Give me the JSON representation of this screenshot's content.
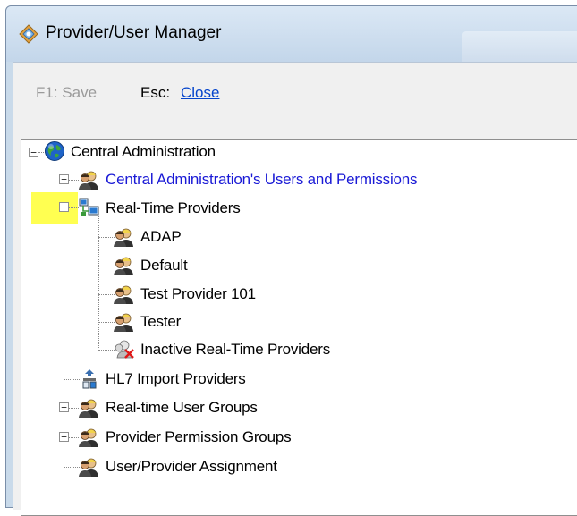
{
  "window": {
    "title": "Provider/User Manager"
  },
  "toolbar": {
    "save_label": "F1: Save",
    "esc_key": "Esc:",
    "close_label": "Close"
  },
  "tree": {
    "root": "Central Administration",
    "items": {
      "users_permissions": "Central Administration's Users and Permissions",
      "realtime_providers": "Real-Time Providers",
      "adap": "ADAP",
      "default": "Default",
      "test_provider": "Test Provider 101",
      "tester": "Tester",
      "inactive": "Inactive Real-Time Providers",
      "hl7": "HL7 Import Providers",
      "rt_user_groups": "Real-time User Groups",
      "perm_groups": "Provider Permission Groups",
      "assignment": "User/Provider Assignment"
    }
  },
  "colors": {
    "link_blue": "#1a1ad6",
    "highlight": "#ffff33"
  }
}
